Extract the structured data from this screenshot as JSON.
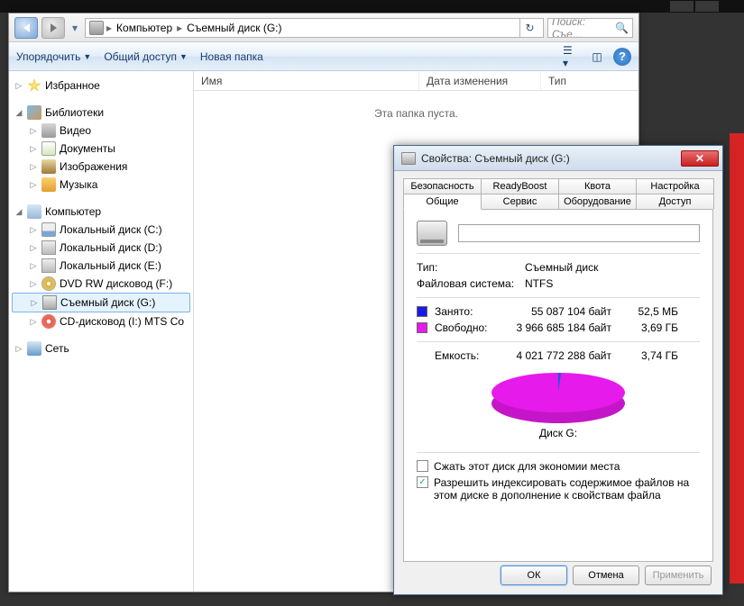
{
  "addressbar": {
    "crumb1": "Компьютер",
    "crumb2": "Съемный диск (G:)",
    "search_placeholder": "Поиск: Съе…"
  },
  "cmdbar": {
    "organize": "Упорядочить",
    "share": "Общий доступ",
    "newfolder": "Новая папка"
  },
  "columns": {
    "name": "Имя",
    "date": "Дата изменения",
    "type": "Тип"
  },
  "empty_msg": "Эта папка пуста.",
  "sidebar": {
    "favorites": "Избранное",
    "libraries": "Библиотеки",
    "video": "Видео",
    "documents": "Документы",
    "images": "Изображения",
    "music": "Музыка",
    "computer": "Компьютер",
    "drive_c": "Локальный диск (C:)",
    "drive_d": "Локальный диск (D:)",
    "drive_e": "Локальный диск (E:)",
    "drive_f": "DVD RW дисковод (F:)",
    "drive_g": "Съемный диск (G:)",
    "drive_i": "CD-дисковод (I:) MTS Co",
    "network": "Сеть"
  },
  "props": {
    "title": "Свойства: Съемный диск (G:)",
    "tabs_row1": {
      "security": "Безопасность",
      "readyboost": "ReadyBoost",
      "quota": "Квота",
      "custom": "Настройка"
    },
    "tabs_row2": {
      "general": "Общие",
      "tools": "Сервис",
      "hardware": "Оборудование",
      "sharing": "Доступ"
    },
    "type_label": "Тип:",
    "type_value": "Съемный диск",
    "fs_label": "Файловая система:",
    "fs_value": "NTFS",
    "used_label": "Занято:",
    "used_bytes": "55 087 104 байт",
    "used_hr": "52,5 МБ",
    "free_label": "Свободно:",
    "free_bytes": "3 966 685 184 байт",
    "free_hr": "3,69 ГБ",
    "cap_label": "Емкость:",
    "cap_bytes": "4 021 772 288 байт",
    "cap_hr": "3,74 ГБ",
    "pie_label": "Диск G:",
    "chk_compress": "Сжать этот диск для экономии места",
    "chk_index": "Разрешить индексировать содержимое файлов на этом диске в дополнение к свойствам файла",
    "btn_ok": "ОК",
    "btn_cancel": "Отмена",
    "btn_apply": "Применить"
  },
  "chart_data": {
    "type": "pie",
    "title": "Диск G:",
    "series": [
      {
        "name": "Занято",
        "value_bytes": 55087104,
        "value_hr": "52,5 МБ",
        "color": "#1a1ae6"
      },
      {
        "name": "Свободно",
        "value_bytes": 3966685184,
        "value_hr": "3,69 ГБ",
        "color": "#e61aea"
      }
    ],
    "total_bytes": 4021772288,
    "total_hr": "3,74 ГБ"
  }
}
